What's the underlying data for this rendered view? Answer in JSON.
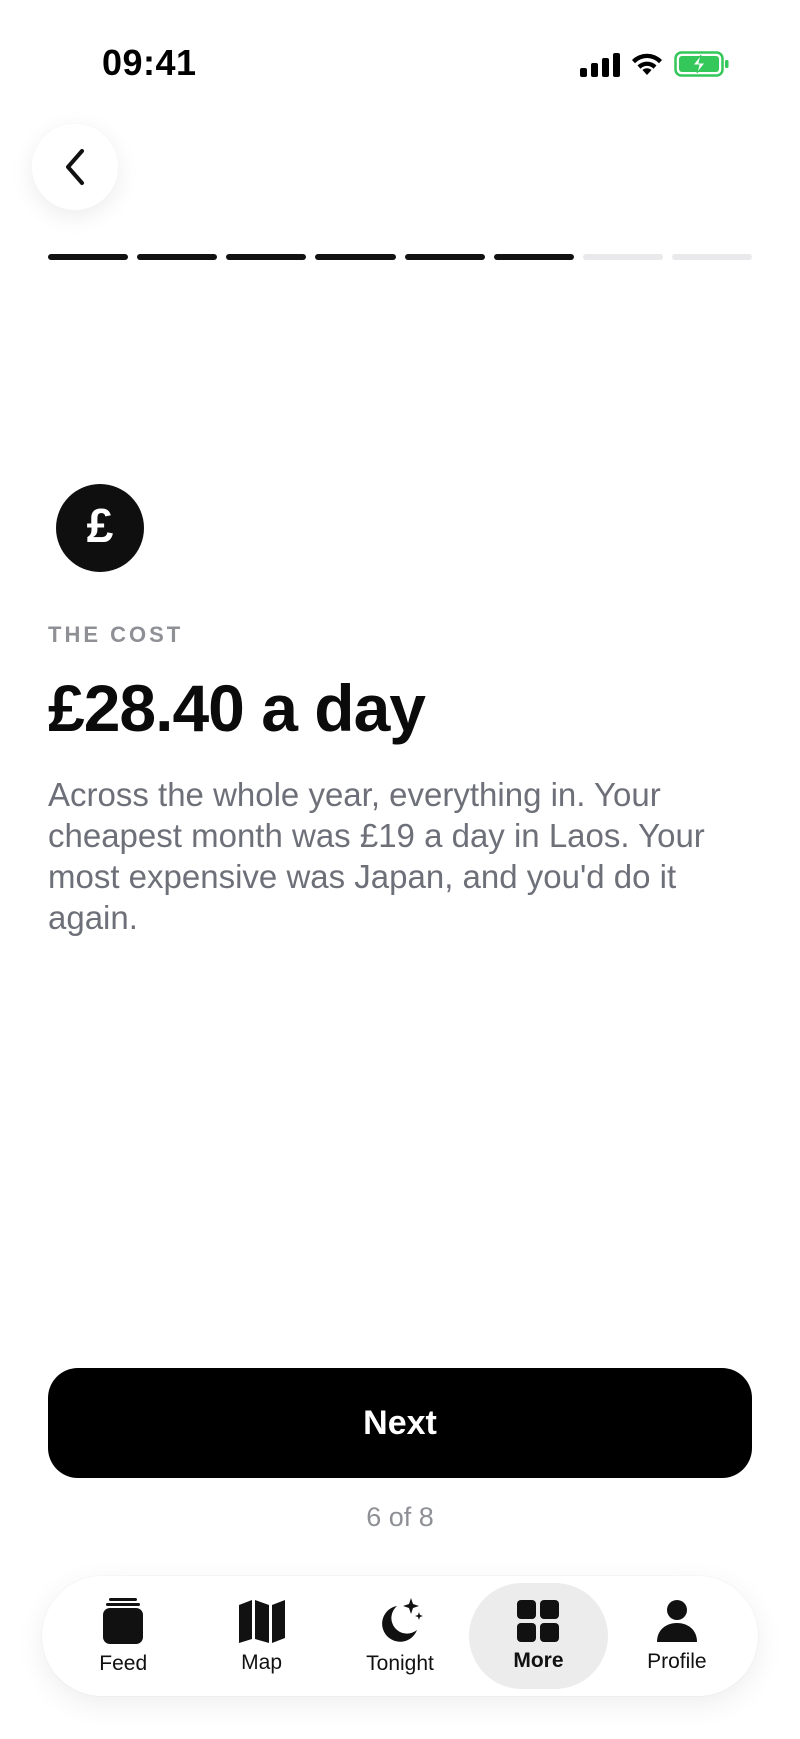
{
  "status": {
    "time": "09:41"
  },
  "progress": {
    "current_step": 6,
    "total_steps": 8
  },
  "content": {
    "icon_symbol": "£",
    "eyebrow": "THE COST",
    "headline": "£28.40 a day",
    "body": "Across the whole year, everything in. Your cheapest month was £19 a day in Laos. Your most expensive was Japan, and you'd do it again."
  },
  "actions": {
    "next_label": "Next",
    "page_count": "6 of 8"
  },
  "tabs": [
    {
      "label": "Feed",
      "icon": "feed-icon",
      "active": false
    },
    {
      "label": "Map",
      "icon": "map-icon",
      "active": false
    },
    {
      "label": "Tonight",
      "icon": "moon-stars-icon",
      "active": false
    },
    {
      "label": "More",
      "icon": "grid-icon",
      "active": true
    },
    {
      "label": "Profile",
      "icon": "person-icon",
      "active": false
    }
  ],
  "colors": {
    "accent": "#000000",
    "battery": "#34c759",
    "muted": "#8e9096",
    "body": "#6e7079"
  }
}
